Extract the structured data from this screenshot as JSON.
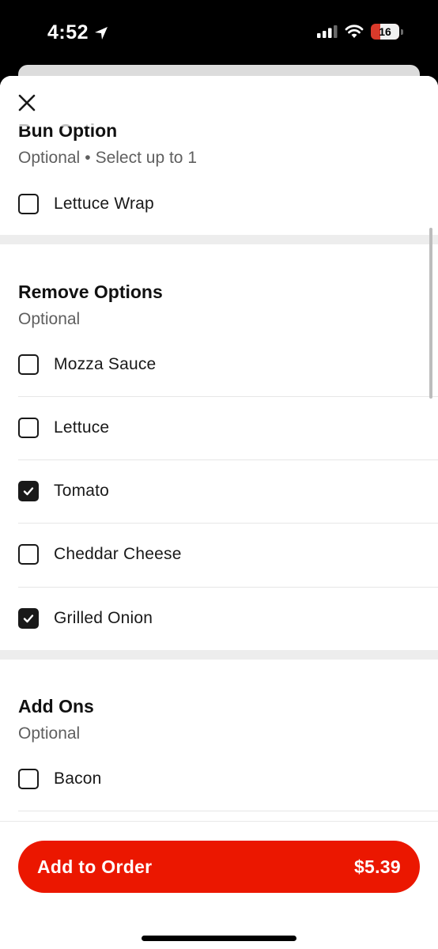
{
  "status_bar": {
    "time": "4:52",
    "battery_level": "16"
  },
  "sheet": {
    "sections": [
      {
        "title": "Bun Option",
        "subtitle_primary": "Optional",
        "subtitle_separator": "•",
        "subtitle_secondary": "Select up to 1",
        "options": [
          {
            "label": "Lettuce Wrap",
            "checked": false
          }
        ]
      },
      {
        "title": "Remove Options",
        "subtitle_primary": "Optional",
        "options": [
          {
            "label": "Mozza Sauce",
            "checked": false
          },
          {
            "label": "Lettuce",
            "checked": false
          },
          {
            "label": "Tomato",
            "checked": true
          },
          {
            "label": "Cheddar Cheese",
            "checked": false
          },
          {
            "label": "Grilled Onion",
            "checked": true
          }
        ]
      },
      {
        "title": "Add Ons",
        "subtitle_primary": "Optional",
        "options": [
          {
            "label": "Bacon",
            "checked": false
          }
        ]
      }
    ]
  },
  "footer": {
    "cta_label": "Add to Order",
    "cta_price": "$5.39"
  },
  "colors": {
    "accent": "#eb1700",
    "checkbox": "#191919",
    "divider": "#ededed"
  },
  "icons": [
    "close-icon",
    "location-arrow-icon",
    "cellular-signal-icon",
    "wifi-icon",
    "battery-icon",
    "checkmark-icon"
  ]
}
